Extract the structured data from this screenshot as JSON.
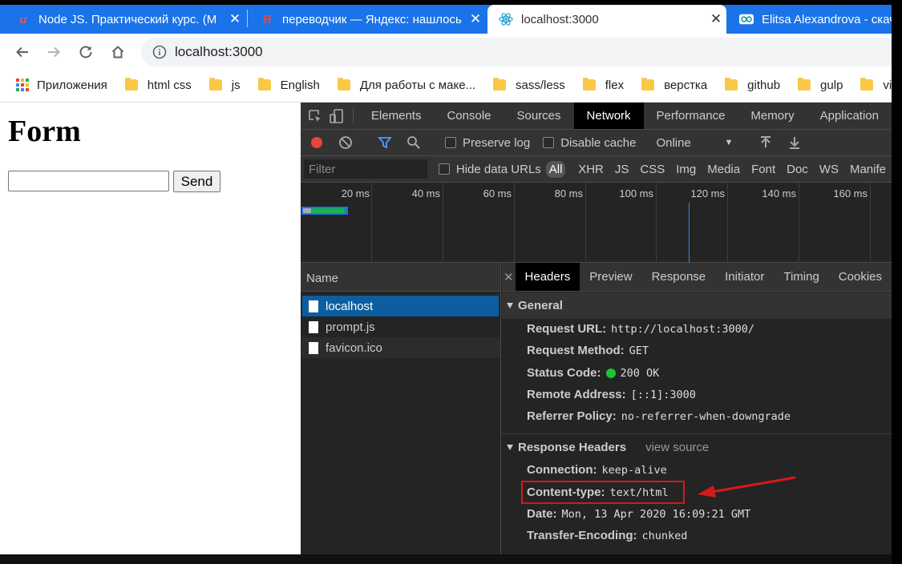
{
  "browser": {
    "tabs": [
      {
        "title": "Node JS. Практический курс. (М",
        "icon": "udemy-icon",
        "active": false
      },
      {
        "title": "переводчик — Яндекс: нашлось",
        "icon": "yandex-icon",
        "active": false
      },
      {
        "title": "localhost:3000",
        "icon": "react-icon",
        "active": true
      },
      {
        "title": "Elitsa Alexandrova - скача",
        "icon": "arduino-icon",
        "active": false
      }
    ],
    "url": "localhost:3000",
    "bookmarks": [
      {
        "label": "Приложения",
        "type": "apps"
      },
      {
        "label": "html css",
        "type": "folder"
      },
      {
        "label": "js",
        "type": "folder"
      },
      {
        "label": "English",
        "type": "folder"
      },
      {
        "label": "Для работы с маке...",
        "type": "folder"
      },
      {
        "label": "sass/less",
        "type": "folder"
      },
      {
        "label": "flex",
        "type": "folder"
      },
      {
        "label": "верстка",
        "type": "folder"
      },
      {
        "label": "github",
        "type": "folder"
      },
      {
        "label": "gulp",
        "type": "folder"
      },
      {
        "label": "vis",
        "type": "folder"
      }
    ]
  },
  "page": {
    "heading": "Form",
    "input_value": "",
    "send_label": "Send"
  },
  "devtools": {
    "tabs": [
      "Elements",
      "Console",
      "Sources",
      "Network",
      "Performance",
      "Memory",
      "Application"
    ],
    "active_tab": "Network",
    "toolbar": {
      "preserve_log": "Preserve log",
      "disable_cache": "Disable cache",
      "throttling": "Online"
    },
    "filter_placeholder": "Filter",
    "hide_data_urls": "Hide data URLs",
    "type_filters": [
      "All",
      "XHR",
      "JS",
      "CSS",
      "Img",
      "Media",
      "Font",
      "Doc",
      "WS",
      "Manife"
    ],
    "timeline_ticks": [
      "20 ms",
      "40 ms",
      "60 ms",
      "80 ms",
      "100 ms",
      "120 ms",
      "140 ms",
      "160 ms"
    ],
    "requests_header": "Name",
    "requests": [
      "localhost",
      "prompt.js",
      "favicon.ico"
    ],
    "detail_tabs": [
      "Headers",
      "Preview",
      "Response",
      "Initiator",
      "Timing",
      "Cookies"
    ],
    "general": {
      "title": "General",
      "rows": [
        {
          "key": "Request URL:",
          "value": "http://localhost:3000/"
        },
        {
          "key": "Request Method:",
          "value": "GET"
        },
        {
          "key": "Status Code:",
          "value": "200 OK"
        },
        {
          "key": "Remote Address:",
          "value": "[::1]:3000"
        },
        {
          "key": "Referrer Policy:",
          "value": "no-referrer-when-downgrade"
        }
      ]
    },
    "response_headers": {
      "title": "Response Headers",
      "view_source": "view source",
      "rows": [
        {
          "key": "Connection:",
          "value": "keep-alive"
        },
        {
          "key": "Content-type:",
          "value": "text/html"
        },
        {
          "key": "Date:",
          "value": "Mon, 13 Apr 2020 16:09:21 GMT"
        },
        {
          "key": "Transfer-Encoding:",
          "value": "chunked"
        }
      ]
    }
  },
  "colors": {
    "chrome_blue": "#1a73e8",
    "annotation_red": "#d21b1b",
    "selected_row": "#0c5ea0",
    "status_green": "#1ec436"
  }
}
